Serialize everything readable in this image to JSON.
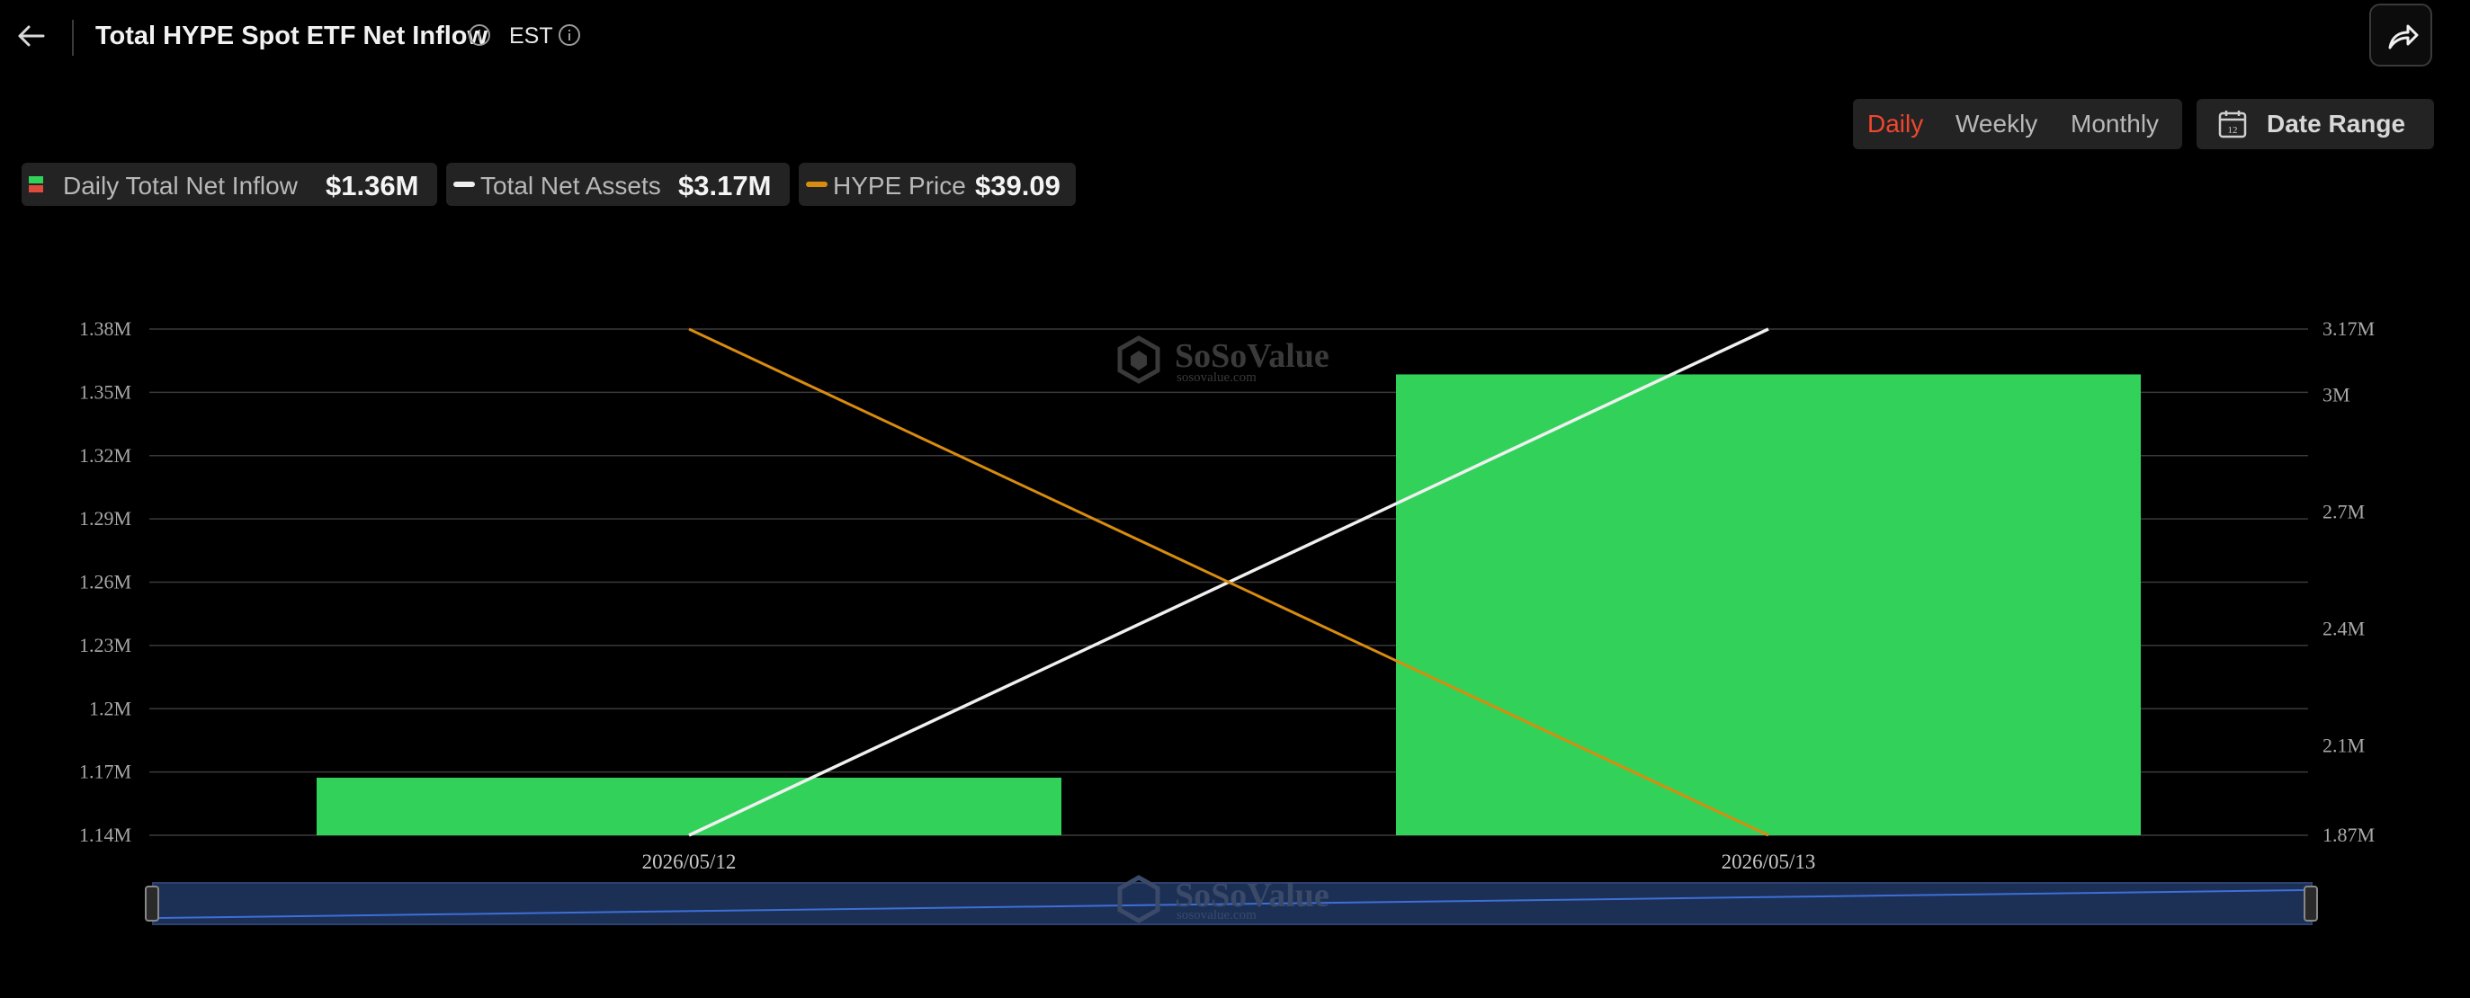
{
  "header": {
    "title": "Total HYPE Spot ETF Net Inflow",
    "timezone": "EST"
  },
  "period_tabs": [
    {
      "label": "Daily",
      "active": true
    },
    {
      "label": "Weekly",
      "active": false
    },
    {
      "label": "Monthly",
      "active": false
    }
  ],
  "date_range_label": "Date Range",
  "legend": [
    {
      "label": "Daily Total Net Inflow",
      "value": "$1.36M",
      "icon": "red-green-bar-icon"
    },
    {
      "label": "Total Net Assets",
      "value": "$3.17M",
      "icon": "white-line-icon"
    },
    {
      "label": "HYPE Price",
      "value": "$39.09",
      "icon": "orange-line-icon"
    }
  ],
  "watermark": {
    "name": "SoSoValue",
    "url": "sosovalue.com"
  },
  "colors": {
    "bar_positive": "#32d25a",
    "net_assets_line": "#f0f0f0",
    "price_line": "#d98c0e",
    "active_tab": "#f0462e",
    "navigator_fill": "#1c2f55",
    "navigator_line": "#3d6fd6"
  },
  "chart_data": {
    "type": "bar",
    "categories": [
      "2026/05/12",
      "2026/05/13"
    ],
    "series": [
      {
        "name": "Daily Total Net Inflow",
        "type": "bar",
        "axis": "left",
        "values": [
          1.1673,
          1.3585
        ]
      },
      {
        "name": "Total Net Assets",
        "type": "line",
        "axis": "right",
        "values": [
          1.87,
          3.17
        ]
      },
      {
        "name": "HYPE Price",
        "type": "line",
        "axis": "hidden",
        "values": [
          null,
          39.09
        ]
      }
    ],
    "left_axis": {
      "unit": "M",
      "ylim": [
        1.14,
        1.38
      ],
      "ticks": [
        {
          "value": 1.14,
          "label": "1.14M"
        },
        {
          "value": 1.17,
          "label": "1.17M"
        },
        {
          "value": 1.2,
          "label": "1.2M"
        },
        {
          "value": 1.23,
          "label": "1.23M"
        },
        {
          "value": 1.26,
          "label": "1.26M"
        },
        {
          "value": 1.29,
          "label": "1.29M"
        },
        {
          "value": 1.32,
          "label": "1.32M"
        },
        {
          "value": 1.35,
          "label": "1.35M"
        },
        {
          "value": 1.38,
          "label": "1.38M"
        }
      ]
    },
    "right_axis": {
      "unit": "M",
      "ylim": [
        1.87,
        3.17
      ],
      "ticks": [
        {
          "value": 1.87,
          "label": "1.87M"
        },
        {
          "value": 2.1,
          "label": "2.1M"
        },
        {
          "value": 2.4,
          "label": "2.4M"
        },
        {
          "value": 2.7,
          "label": "2.7M"
        },
        {
          "value": 3.0,
          "label": "3M"
        },
        {
          "value": 3.17,
          "label": "3.17M"
        }
      ]
    },
    "price_line_direction": "descending",
    "grid": true,
    "legend_position": "top-left"
  }
}
